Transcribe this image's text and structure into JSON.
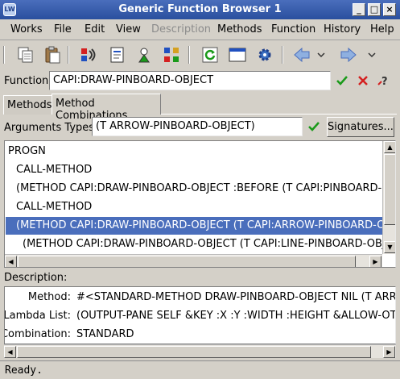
{
  "window": {
    "title": "Generic Function Browser 1",
    "icon_label": "LW"
  },
  "menu": {
    "works": "Works",
    "file": "File",
    "edit": "Edit",
    "view": "View",
    "description": "Description",
    "methods": "Methods",
    "function": "Function",
    "history": "History",
    "help": "Help"
  },
  "function_row": {
    "label": "Function:",
    "value": "CAPI:DRAW-PINBOARD-OBJECT"
  },
  "tabs": {
    "methods": "Methods",
    "method_combinations": "Method Combinations"
  },
  "arguments": {
    "label": "Arguments Types:",
    "value": "(T ARROW-PINBOARD-OBJECT)",
    "signatures_button": "Signatures..."
  },
  "combination_list": [
    "PROGN",
    "CALL-METHOD",
    "(METHOD CAPI:DRAW-PINBOARD-OBJECT :BEFORE (T CAPI:PINBOARD-OBJECT))",
    "CALL-METHOD",
    "(METHOD CAPI:DRAW-PINBOARD-OBJECT (T CAPI:ARROW-PINBOARD-OBJECT))",
    "(METHOD CAPI:DRAW-PINBOARD-OBJECT (T CAPI:LINE-PINBOARD-OBJECT))"
  ],
  "selected_index": 4,
  "description": {
    "label": "Description:",
    "method_label": "Method:",
    "method_value": "#<STANDARD-METHOD DRAW-PINBOARD-OBJECT NIL (T ARROW-PINBOARD-OBJECT)>",
    "lambda_label": "Lambda List:",
    "lambda_value": "(OUTPUT-PANE SELF &KEY :X :Y :WIDTH :HEIGHT &ALLOW-OTHER-KEYS)",
    "combination_label": "Combination:",
    "combination_value": "STANDARD"
  },
  "status": {
    "text": "Ready."
  },
  "colors": {
    "selection": "#4a6ebc",
    "title_bar": "#2a4f9e",
    "check_green": "#1a9a1a",
    "cross_red": "#d42020"
  }
}
